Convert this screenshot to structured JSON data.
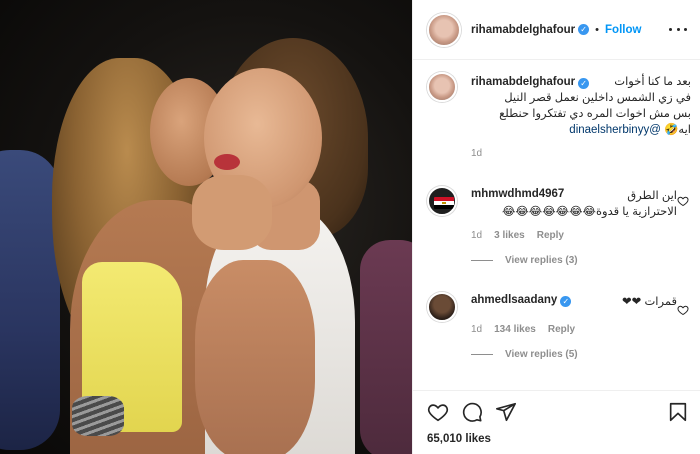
{
  "post": {
    "username": "rihamabdelghafour",
    "verified_badge": "✓",
    "separator": "•",
    "follow_label": "Follow",
    "caption": {
      "line_1": "بعد ما كنا أخوات",
      "line_2": "في زي الشمس داخلين نعمل قصر النيل",
      "line_3": "بس مش اخوات المره دي تفتكروا حنطلع",
      "mention": "@dinaelsherbinyy",
      "line_4_suffix": "ايه🤣",
      "age": "1d"
    },
    "likes": "65,010 likes"
  },
  "comments": [
    {
      "username": "mhmwdhmd4967",
      "text_1": "اين الطرق",
      "text_2": "الاحترازية يا قدوة😂😂😂😂😂😂😂",
      "age": "1d",
      "likes": "3 likes",
      "reply_label": "Reply",
      "view_replies": "View replies (3)",
      "avatar_icon": "egypt-flag"
    },
    {
      "username": "ahmedlsaadany",
      "verified_badge": "✓",
      "text_1": "قمرات ❤❤",
      "age": "1d",
      "likes": "134 likes",
      "reply_label": "Reply",
      "view_replies": "View replies (5)"
    }
  ],
  "icons": {
    "like": "heart-icon",
    "comment": "comment-icon",
    "share": "share-icon",
    "save": "bookmark-icon",
    "comment_like": "heart-icon",
    "menu": "more-icon"
  },
  "colors": {
    "accent": "#0095f6",
    "verified": "#3897f0",
    "muted": "#8e8e8e",
    "text": "#262626",
    "mention": "#00376b"
  }
}
